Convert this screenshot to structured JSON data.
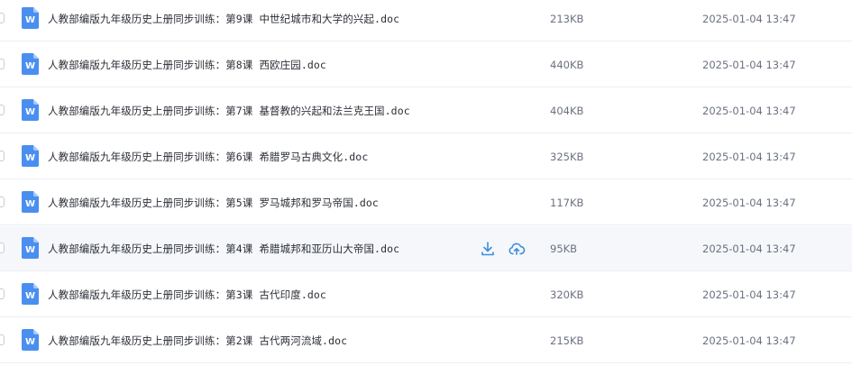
{
  "colors": {
    "accent": "#3b8fd9",
    "word_icon": "#4a8ff0",
    "text_primary": "#2b2f36",
    "text_secondary": "#6b7280",
    "row_hover": "#f5f7fb",
    "divider": "#eceef2"
  },
  "icons": {
    "file": "word-doc-icon",
    "download": "download-icon",
    "save_to_cloud": "cloud-upload-icon"
  },
  "file_icon_letter": "W",
  "files": [
    {
      "name": "人教部编版九年级历史上册同步训练：第9课  中世纪城市和大学的兴起.doc",
      "size": "213KB",
      "modified": "2025-01-04 13:47",
      "hovered": false
    },
    {
      "name": "人教部编版九年级历史上册同步训练：第8课  西欧庄园.doc",
      "size": "440KB",
      "modified": "2025-01-04 13:47",
      "hovered": false
    },
    {
      "name": "人教部编版九年级历史上册同步训练：第7课  基督教的兴起和法兰克王国.doc",
      "size": "404KB",
      "modified": "2025-01-04 13:47",
      "hovered": false
    },
    {
      "name": "人教部编版九年级历史上册同步训练：第6课  希腊罗马古典文化.doc",
      "size": "325KB",
      "modified": "2025-01-04 13:47",
      "hovered": false
    },
    {
      "name": "人教部编版九年级历史上册同步训练：第5课  罗马城邦和罗马帝国.doc",
      "size": "117KB",
      "modified": "2025-01-04 13:47",
      "hovered": false
    },
    {
      "name": "人教部编版九年级历史上册同步训练：第4课  希腊城邦和亚历山大帝国.doc",
      "size": "95KB",
      "modified": "2025-01-04 13:47",
      "hovered": true
    },
    {
      "name": "人教部编版九年级历史上册同步训练：第3课  古代印度.doc",
      "size": "320KB",
      "modified": "2025-01-04 13:47",
      "hovered": false
    },
    {
      "name": "人教部编版九年级历史上册同步训练：第2课  古代两河流域.doc",
      "size": "215KB",
      "modified": "2025-01-04 13:47",
      "hovered": false
    }
  ]
}
